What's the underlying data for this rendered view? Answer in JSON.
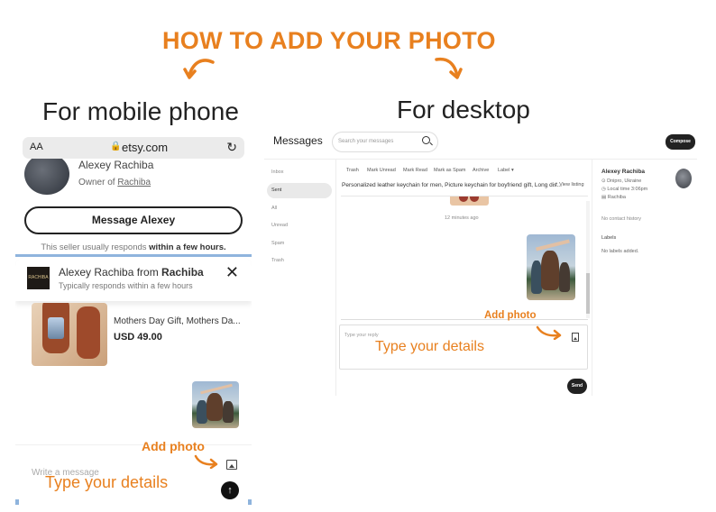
{
  "header": {
    "title": "HOW TO ADD YOUR PHOTO",
    "mobile_label": "For mobile phone",
    "desktop_label": "For desktop",
    "accent_color": "#e8801f"
  },
  "mobile": {
    "browser": {
      "text_size_label": "AA",
      "lock_icon": "lock-icon",
      "url": "etsy.com",
      "reload_icon": "reload-icon"
    },
    "seller": {
      "name": "Alexey Rachiba",
      "owner_prefix": "Owner of ",
      "shop": "Rachiba"
    },
    "message_button": "Message Alexey",
    "responds_prefix": "This seller usually responds ",
    "responds_bold": "within a few hours.",
    "conversation": {
      "logo_text": "RACHIBA",
      "title_prefix": "Alexey Rachiba from ",
      "title_shop": "Rachiba",
      "subtitle": "Typically responds within a few hours",
      "close_icon": "✕"
    },
    "product": {
      "title": "Mothers Day Gift, Mothers Da...",
      "price": "USD 49.00"
    },
    "composer": {
      "placeholder": "Write a message",
      "photo_icon": "image-icon",
      "send_icon": "↑"
    },
    "annotations": {
      "add_photo": "Add photo",
      "type_details": "Type your details"
    }
  },
  "desktop": {
    "title": "Messages",
    "search_placeholder": "Search your messages",
    "compose_label": "Compose",
    "sidebar": {
      "items": [
        {
          "label": "Inbox",
          "active": false
        },
        {
          "label": "Sent",
          "active": true
        },
        {
          "label": "All",
          "active": false
        },
        {
          "label": "Unread",
          "active": false
        },
        {
          "label": "Spam",
          "active": false
        },
        {
          "label": "Trash",
          "active": false
        }
      ]
    },
    "toolbar": [
      "Trash",
      "Mark Unread",
      "Mark Read",
      "Mark as Spam",
      "Archive",
      "Label ▾"
    ],
    "listing_title": "Personalized leather keychain for men, Picture keychain for boyfriend gift, Long dis...",
    "view_listing": "↗ View listing",
    "time_ago": "12 minutes ago",
    "reply_placeholder": "Type your reply",
    "send_label": "Send",
    "contact": {
      "name": "Alexey Rachiba",
      "location": "⊙ Dnipro, Ukraine",
      "local_time": "◷ Local time 3:06pm",
      "shop": "▤ Rachiba",
      "history": "No contact history",
      "labels_heading": "Labels",
      "labels_value": "No labels added."
    },
    "annotations": {
      "add_photo": "Add photo",
      "type_details": "Type your details"
    }
  }
}
